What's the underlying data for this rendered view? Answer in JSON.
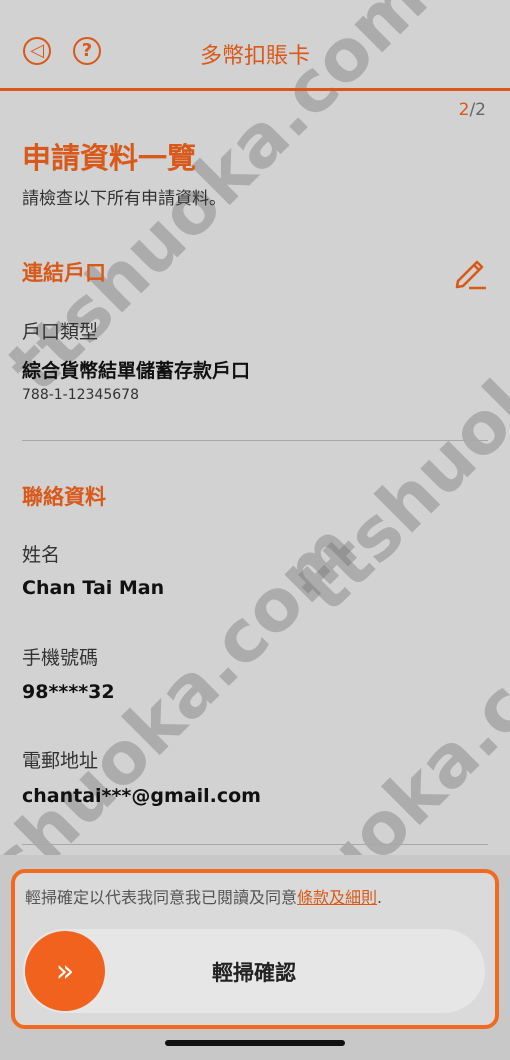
{
  "header": {
    "title": "多幣扣賬卡",
    "back_icon": "back-icon",
    "help_icon": "help-icon",
    "help_glyph": "?",
    "back_glyph": "◁"
  },
  "step": {
    "current": "2",
    "separator": "/",
    "total": "2"
  },
  "page": {
    "title": "申請資料一覽",
    "subtitle": "請檢查以下所有申請資料。"
  },
  "linked_account": {
    "section_title": "連結戶口",
    "edit_icon": "pencil-icon",
    "type_label": "戶口類型",
    "type_value": "綜合貨幣結單儲蓄存款戶口",
    "account_number": "788-1-12345678"
  },
  "contact": {
    "section_title": "聯絡資料",
    "name_label": "姓名",
    "name_value": "Chan Tai Man",
    "mobile_label": "手機號碼",
    "mobile_value": "98****32",
    "email_label": "電郵地址",
    "email_value": "chantai***@gmail.com"
  },
  "footer": {
    "terms_prefix": "輕掃確定以代表我同意我已閱讀及同意",
    "terms_link": "條款及細則",
    "terms_suffix": ".",
    "slider_label": "輕掃確認",
    "slider_glyph": "»"
  },
  "watermark": {
    "text": "ttshuoka.com"
  },
  "colors": {
    "accent": "#d8591a",
    "knob": "#f0621d",
    "border": "#f06a22"
  }
}
